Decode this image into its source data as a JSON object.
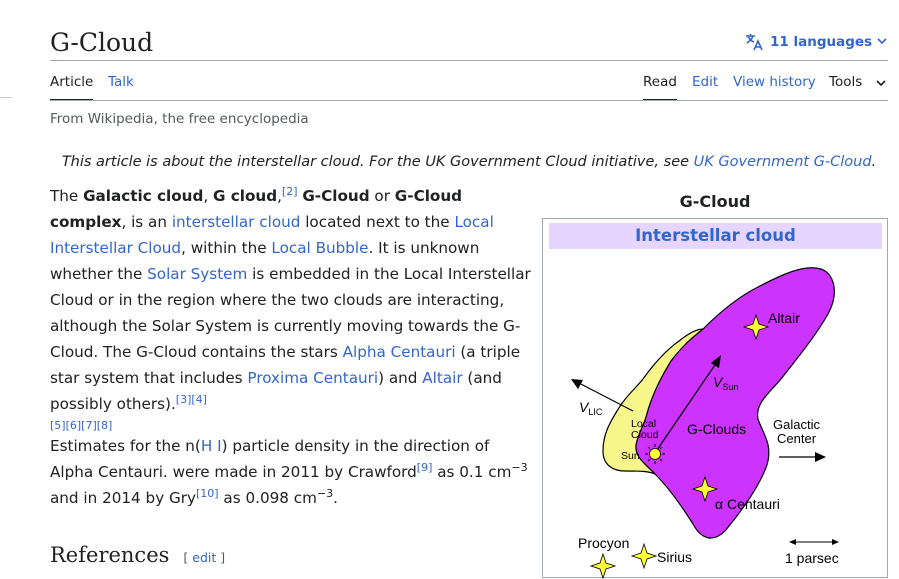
{
  "page": {
    "title": "G-Cloud",
    "languages_label": "11 languages",
    "tagline": "From Wikipedia, the free encyclopedia"
  },
  "tabs": {
    "article": "Article",
    "talk": "Talk",
    "read": "Read",
    "edit": "Edit",
    "view_history": "View history",
    "tools": "Tools"
  },
  "hatnote": {
    "text": "This article is about the interstellar cloud. For the UK Government Cloud initiative, see ",
    "link": "UK Government G-Cloud",
    "end": "."
  },
  "paragraph1": {
    "t1": "The ",
    "b1": "Galactic cloud",
    "t2": ", ",
    "b2": "G cloud",
    "t3": ",",
    "ref2": "[2]",
    "t4": " ",
    "b3": "G-Cloud",
    "t5": " or ",
    "b4": "G-Cloud complex",
    "t6": ", is an ",
    "l1": "interstellar cloud",
    "t7": " located next to the ",
    "l2": "Local Interstellar Cloud",
    "t8": ", within the ",
    "l3": "Local Bubble",
    "t9": ". It is unknown whether the ",
    "l4": "Solar System",
    "t10": " is embedded in the Local Interstellar Cloud or in the region where the two clouds are interacting, although the Solar System is currently moving towards the G-Cloud. The G-Cloud contains the stars ",
    "l5": "Alpha Centauri",
    "t11": " (a triple star system that includes ",
    "l6": "Proxima Centauri",
    "t12": ") and ",
    "l7": "Altair",
    "t13": " (and possibly others).",
    "ref34": "[3][4]",
    "ref5678": "[5][6][7][8]"
  },
  "paragraph2": {
    "t1": "Estimates for the n(",
    "l1": "H I",
    "t2": ") particle density in the direction of Alpha Centauri. were made in 2011 by Crawford",
    "ref9": "[9]",
    "t3": " as 0.1 cm",
    "exp1": "−3",
    "t4": " and in 2014 by Gry",
    "ref10": "[10]",
    "t5": " as 0.098 cm",
    "exp2": "−3",
    "t6": "."
  },
  "references": {
    "heading": "References",
    "edit_open": "[ ",
    "edit_label": "edit",
    "edit_close": " ]"
  },
  "infobox": {
    "title": "G-Cloud",
    "header": "Interstellar cloud",
    "diagram": {
      "altair": "Altair",
      "v_sun": "V",
      "v_sun_sub": "Sun",
      "v_lic": "V",
      "v_lic_sub": "LIC",
      "local_cloud_1": "Local",
      "local_cloud_2": "Cloud",
      "sun": "Sun",
      "g_clouds": "G-Clouds",
      "galactic_1": "Galactic",
      "galactic_2": "Center",
      "alpha_centauri": "α Centauri",
      "procyon": "Procyon",
      "sirius": "Sirius",
      "parsec": "1 parsec",
      "colors": {
        "g_cloud": "#cc33ff",
        "local_cloud": "#f6f68a"
      }
    }
  }
}
